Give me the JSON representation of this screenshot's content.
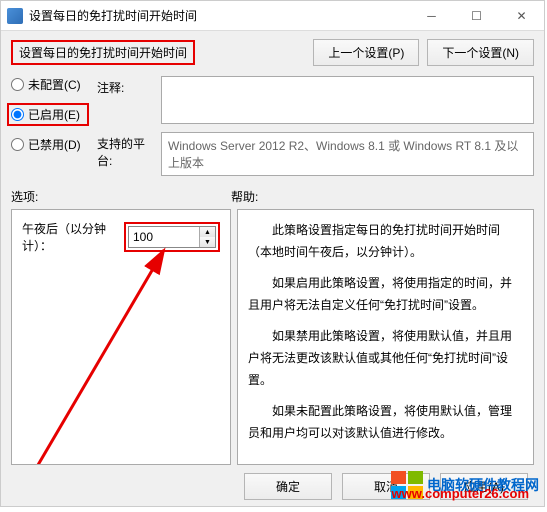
{
  "title": "设置每日的免打扰时间开始时间",
  "heading": "设置每日的免打扰时间开始时间",
  "nav": {
    "prev": "上一个设置(P)",
    "next": "下一个设置(N)"
  },
  "radios": {
    "unconfigured": "未配置(C)",
    "enabled": "已启用(E)",
    "disabled": "已禁用(D)"
  },
  "fields": {
    "comment_label": "注释:",
    "comment_value": "",
    "platform_label": "支持的平台:",
    "platform_value": "Windows Server 2012 R2、Windows 8.1 或 Windows RT 8.1 及以上版本"
  },
  "sections": {
    "options": "选项:",
    "help": "帮助:"
  },
  "option": {
    "label": "午夜后（以分钟计）：",
    "value": "100"
  },
  "help_paragraphs": [
    "此策略设置指定每日的免打扰时间开始时间（本地时间午夜后，以分钟计）。",
    "如果启用此策略设置，将使用指定的时间，并且用户将无法自定义任何“免打扰时间”设置。",
    "如果禁用此策略设置，将使用默认值，并且用户将无法更改该默认值或其他任何“免打扰时间”设置。",
    "如果未配置此策略设置，将使用默认值，管理员和用户均可以对该默认值进行修改。"
  ],
  "footer": {
    "ok": "确定",
    "cancel": "取消",
    "apply": "应用(A)"
  },
  "watermark": {
    "line1": "电脑软硬件教程网",
    "line2": "www.computer26.com"
  }
}
